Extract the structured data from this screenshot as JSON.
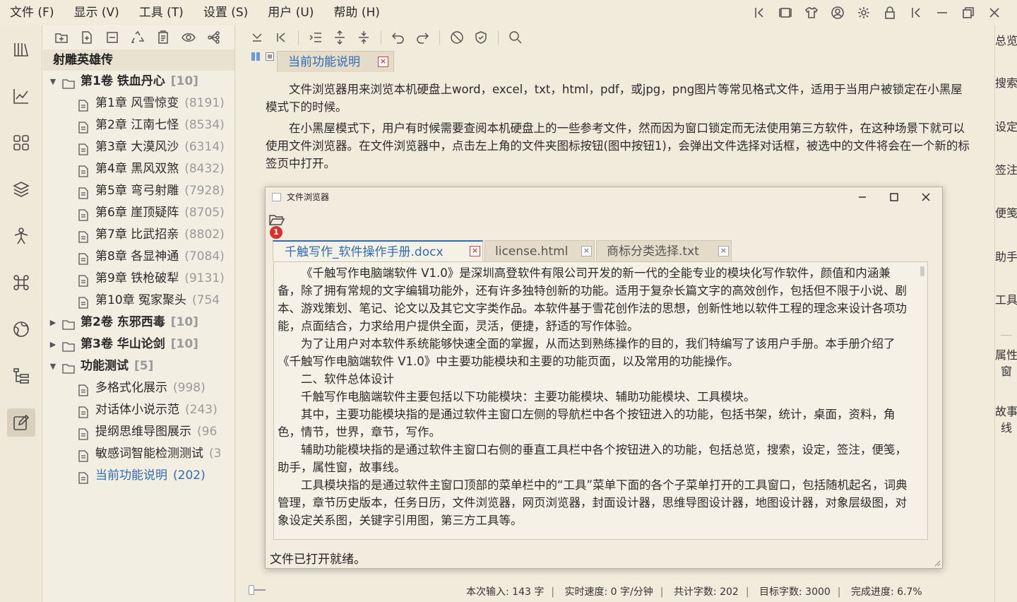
{
  "menu": [
    "文件 (F)",
    "显示 (V)",
    "工具 (T)",
    "设置 (S)",
    "用户 (U)",
    "帮助 (H)"
  ],
  "tree": {
    "book_title": "射雕英雄传",
    "rows": [
      {
        "label": "第1卷 铁血丹心",
        "count": "[10]",
        "type": "vol",
        "expanded": true
      },
      {
        "label": "第1章 风雪惊变",
        "count": "(8191)",
        "type": "chapter"
      },
      {
        "label": "第2章 江南七怪",
        "count": "(8534)",
        "type": "chapter"
      },
      {
        "label": "第3章 大漠风沙",
        "count": "(6314)",
        "type": "chapter"
      },
      {
        "label": "第4章 黑风双煞",
        "count": "(8432)",
        "type": "chapter"
      },
      {
        "label": "第5章 弯弓射雕",
        "count": "(7928)",
        "type": "chapter"
      },
      {
        "label": "第6章 崖顶疑阵",
        "count": "(8705)",
        "type": "chapter"
      },
      {
        "label": "第7章 比武招亲",
        "count": "(8802)",
        "type": "chapter"
      },
      {
        "label": "第8章 各显神通",
        "count": "(7084)",
        "type": "chapter"
      },
      {
        "label": "第9章 铁枪破犁",
        "count": "(9131)",
        "type": "chapter"
      },
      {
        "label": "第10章 冤家聚头",
        "count": "(754",
        "type": "chapter"
      },
      {
        "label": "第2卷 东邪西毒",
        "count": "[10]",
        "type": "vol",
        "expanded": false
      },
      {
        "label": "第3卷 华山论剑",
        "count": "[10]",
        "type": "vol",
        "expanded": false
      },
      {
        "label": "功能测试",
        "count": "[5]",
        "type": "vol",
        "expanded": true
      },
      {
        "label": "多格式化展示",
        "count": "(998)",
        "type": "chapter"
      },
      {
        "label": "对话体小说示范",
        "count": "(243)",
        "type": "chapter"
      },
      {
        "label": "提纲思维导图展示",
        "count": "(96",
        "type": "chapter"
      },
      {
        "label": "敏感词智能检测测试",
        "count": "(3",
        "type": "chapter"
      },
      {
        "label": "当前功能说明",
        "count": "(202)",
        "type": "chapter",
        "selected": true
      }
    ]
  },
  "doc_tab": {
    "label": "当前功能说明"
  },
  "doc": {
    "p1": "文件浏览器用来浏览本机硬盘上word，excel，txt，html，pdf，或jpg，png图片等常见格式文件，适用于当用户被锁定在小黑屋模式下的时候。",
    "p2": "在小黑屋模式下，用户有时候需要查阅本机硬盘上的一些参考文件，然而因为窗口锁定而无法使用第三方软件，在这种场景下就可以使用文件浏览器。在文件浏览器中，点击左上角的文件夹图标按钮(图中按钮1)，会弹出文件选择对话框，被选中的文件将会在一个新的标签页中打开。"
  },
  "dialog": {
    "title": "文件浏览器",
    "badge": "1",
    "tabs": [
      "千触写作_软件操作手册.docx",
      "license.html",
      "商标分类选择.txt"
    ],
    "paragraphs": [
      "《千触写作电脑端软件 V1.0》是深圳高登软件有限公司开发的新一代的全能专业的模块化写作软件，颜值和内涵兼备，除了拥有常规的文字编辑功能外，还有许多独特创新的功能。适用于复杂长篇文字的高效创作，包括但不限于小说、剧本、游戏策划、笔记、论文以及其它文字类作品。本软件基于雪花创作法的思想，创新性地以软件工程的理念来设计各项功能，点面结合，力求给用户提供全面，灵活，便捷，舒适的写作体验。",
      "为了让用户对本软件系统能够快速全面的掌握，从而达到熟练操作的目的，我们特编写了该用户手册。本手册介绍了《千触写作电脑端软件 V1.0》中主要功能模块和主要的功能页面，以及常用的功能操作。",
      "二、软件总体设计",
      "千触写作电脑端软件主要包括以下功能模块：主要功能模块、辅助功能模块、工具模块。",
      "其中，主要功能模块指的是通过软件主窗口左侧的导航栏中各个按钮进入的功能，包括书架，统计，桌面，资料，角色，情节，世界，章节，写作。",
      "辅助功能模块指的是通过软件主窗口右侧的垂直工具栏中各个按钮进入的功能，包括总览，搜索，设定，签注，便笺，助手，属性窗，故事线。",
      "工具模块指的是通过软件主窗口顶部的菜单栏中的“工具”菜单下面的各个子菜单打开的工具窗口，包括随机起名，词典管理，章节历史版本，任务日历，文件浏览器，网页浏览器，封面设计器，思维导图设计器，地图设计器，对象层级图，对象设定关系图，关键字引用图，第三方工具等。"
    ],
    "status": "文件已打开就绪。"
  },
  "statusbar": {
    "input": "本次输入:  143  字",
    "speed": "实时速度:  0 字/分钟",
    "total": "共计字数:  202",
    "target": "目标字数: 3000",
    "progress": "完成进度: 6.7%"
  },
  "rightbar": [
    "总览",
    "搜索",
    "设定",
    "签注",
    "便笺",
    "助手",
    "工具",
    "属性窗",
    "故事线"
  ],
  "colors": {
    "background": "#f1ebdc",
    "accent": "#2f6cb5",
    "badge": "#d93030"
  }
}
